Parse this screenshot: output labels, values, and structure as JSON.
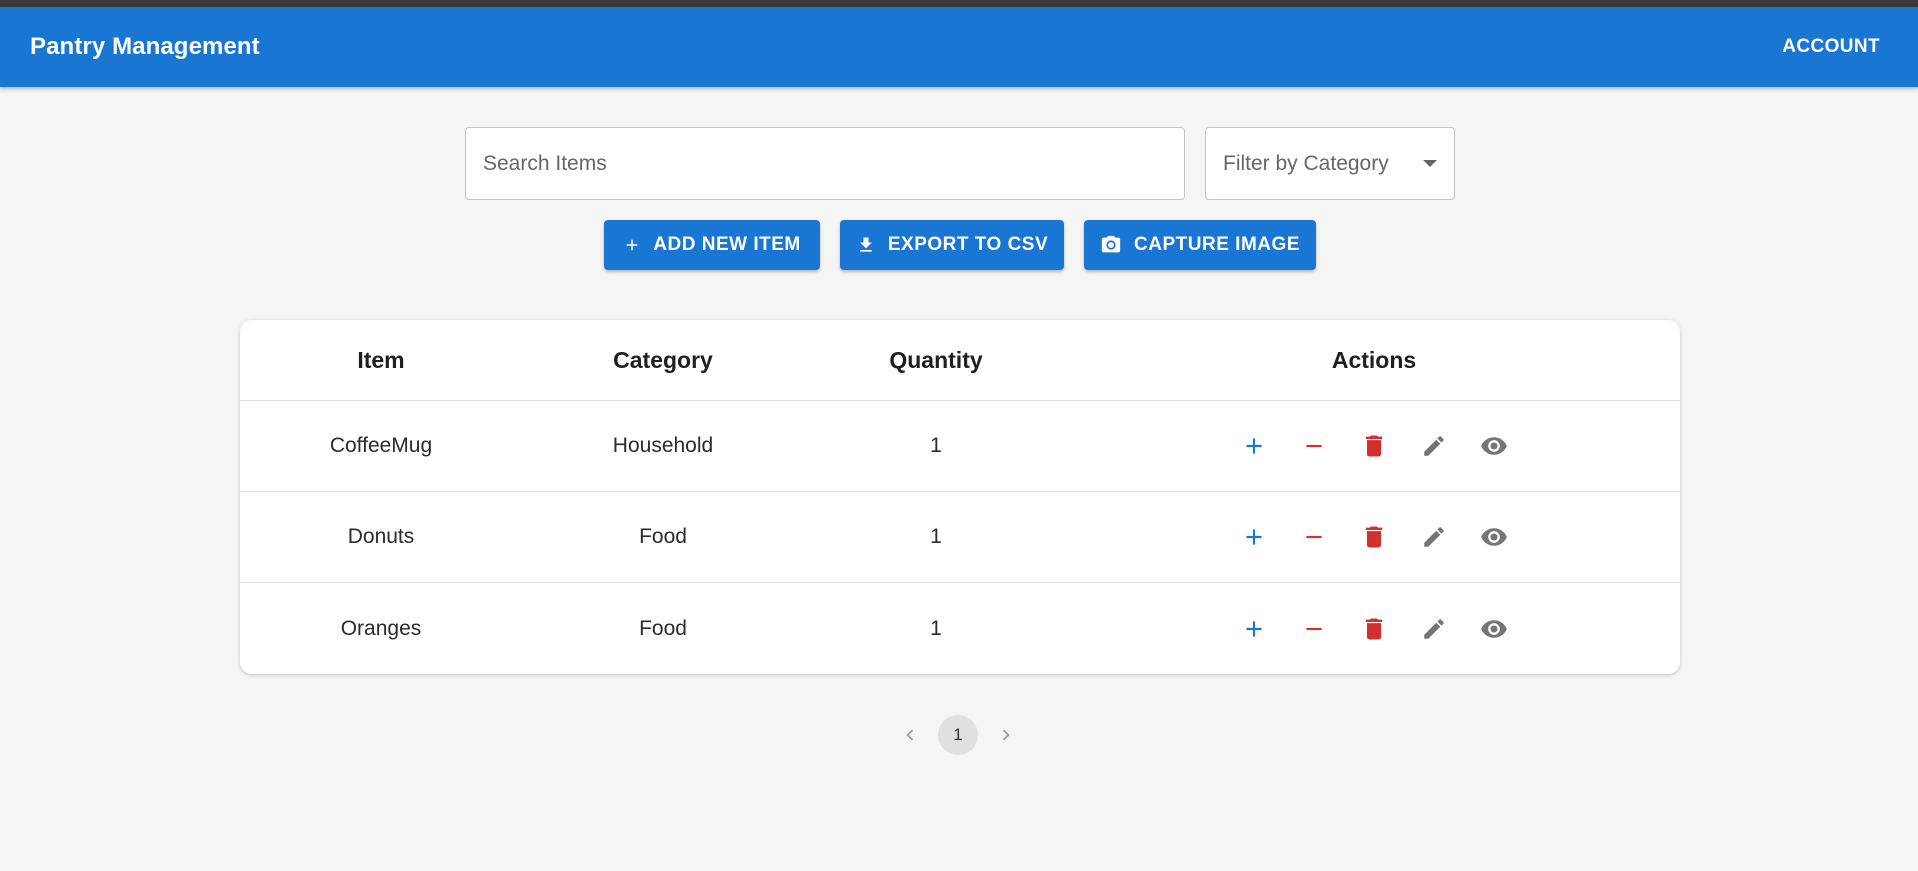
{
  "app": {
    "title": "Pantry Management",
    "account_label": "ACCOUNT"
  },
  "toolbar": {
    "search_placeholder": "Search Items",
    "filter_label": "Filter by Category",
    "add_label": "ADD NEW ITEM",
    "export_label": "EXPORT TO CSV",
    "capture_label": "CAPTURE IMAGE"
  },
  "table": {
    "headers": {
      "item": "Item",
      "category": "Category",
      "quantity": "Quantity",
      "actions": "Actions"
    },
    "rows": [
      {
        "item": "CoffeeMug",
        "category": "Household",
        "quantity": "1"
      },
      {
        "item": "Donuts",
        "category": "Food",
        "quantity": "1"
      },
      {
        "item": "Oranges",
        "category": "Food",
        "quantity": "1"
      }
    ],
    "action_icons": [
      "plus-icon",
      "minus-icon",
      "delete-icon",
      "edit-icon",
      "view-icon"
    ]
  },
  "pagination": {
    "current_page": "1"
  },
  "colors": {
    "primary": "#1976d2",
    "danger": "#d32f2f",
    "neutral_icon": "#757575",
    "background": "#f5f5f5"
  }
}
